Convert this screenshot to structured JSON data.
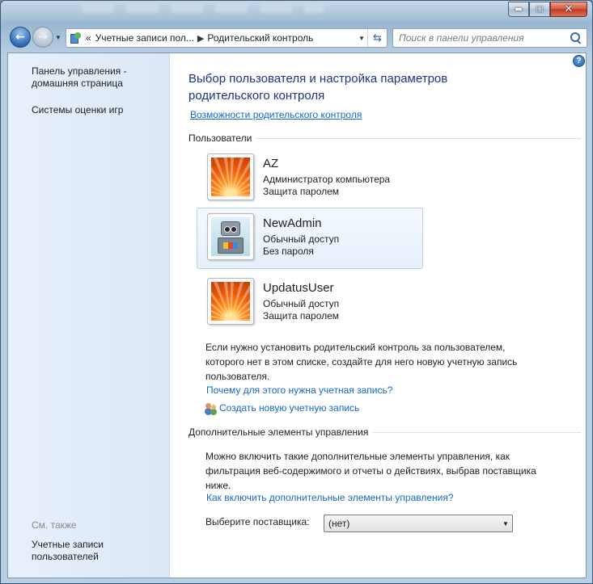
{
  "window": {
    "buttons": {
      "minimize": "▬",
      "maximize": "□",
      "close": "✕"
    }
  },
  "navigation": {
    "back_icon": "arrow-left-icon",
    "forward_icon": "arrow-right-icon",
    "address": {
      "overflow": "«",
      "crumb_1": "Учетные записи пол...",
      "separator": "▶",
      "crumb_2": "Родительский контроль"
    },
    "search": {
      "placeholder": "Поиск в панели управления"
    }
  },
  "sidebar": {
    "home_link": "Панель управления - домашняя страница",
    "games_link": "Системы оценки игр",
    "see_also_label": "См. также",
    "accounts_link": "Учетные записи пользователей"
  },
  "main": {
    "help": "?",
    "title": "Выбор пользователя и настройка параметров родительского контроля",
    "features_link": "Возможности родительского контроля",
    "users_header": "Пользователи",
    "users": [
      {
        "name": "AZ",
        "role": "Администратор компьютера",
        "password": "Защита паролем",
        "avatar": "flower",
        "selected": false
      },
      {
        "name": "NewAdmin",
        "role": "Обычный доступ",
        "password": "Без пароля",
        "avatar": "robot",
        "selected": true
      },
      {
        "name": "UpdatusUser",
        "role": "Обычный доступ",
        "password": "Защита паролем",
        "avatar": "flower",
        "selected": false
      }
    ],
    "info_text": "Если нужно установить родительский контроль за пользователем, которого нет в этом списке, создайте для него новую учетную запись пользователя.",
    "why_link": "Почему для этого нужна учетная запись?",
    "create_link": "Создать новую учетную запись",
    "extra_header": "Дополнительные элементы управления",
    "extra_text": "Можно включить такие дополнительные элементы управления, как фильтрация веб-содержимого и отчеты о действиях, выбрав поставщика ниже.",
    "extra_link": "Как включить дополнительные элементы управления?",
    "provider_label": "Выберите поставщика:",
    "provider_value": "(нет)"
  }
}
